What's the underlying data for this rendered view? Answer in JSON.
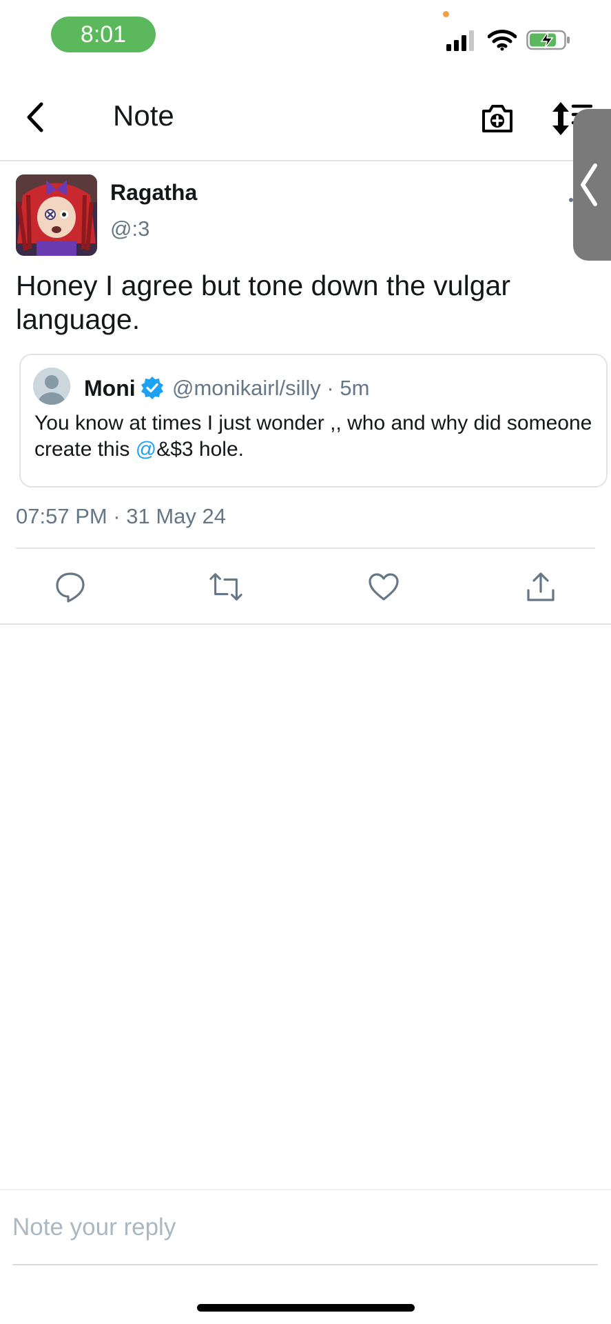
{
  "status_bar": {
    "time": "8:01",
    "signal_icon": "cellular-signal-icon",
    "wifi_icon": "wifi-icon",
    "battery_icon": "battery-charging-icon",
    "time_pill_color": "#5cb85c"
  },
  "header": {
    "title": "Note",
    "back_icon": "chevron-left-icon",
    "camera_icon": "camera-plus-icon",
    "sort_icon": "sort-icon"
  },
  "side_tab": {
    "icon": "chevron-left-icon"
  },
  "post": {
    "author_name": "Ragatha",
    "author_handle": "@:3",
    "text": "Honey I agree but tone down the vulgar language.",
    "timestamp": "07:57 PM · 31 May 24"
  },
  "quote": {
    "name": "Moni",
    "meta": "@monikairl/silly · 5m",
    "text_before": "You know at times I just wonder ,, who and why did someone create this ",
    "mention": "@",
    "text_after": "&$3 hole.",
    "verified_icon": "verified-badge-icon"
  },
  "actions": [
    {
      "name": "reply",
      "icon": "comment-icon"
    },
    {
      "name": "renote",
      "icon": "repost-icon"
    },
    {
      "name": "like",
      "icon": "heart-icon"
    },
    {
      "name": "share",
      "icon": "share-icon"
    }
  ],
  "reply": {
    "placeholder": "Note your reply"
  },
  "colors": {
    "accent": "#1da1f2",
    "secondary_text": "#657786",
    "divider": "#e1e4e6"
  }
}
